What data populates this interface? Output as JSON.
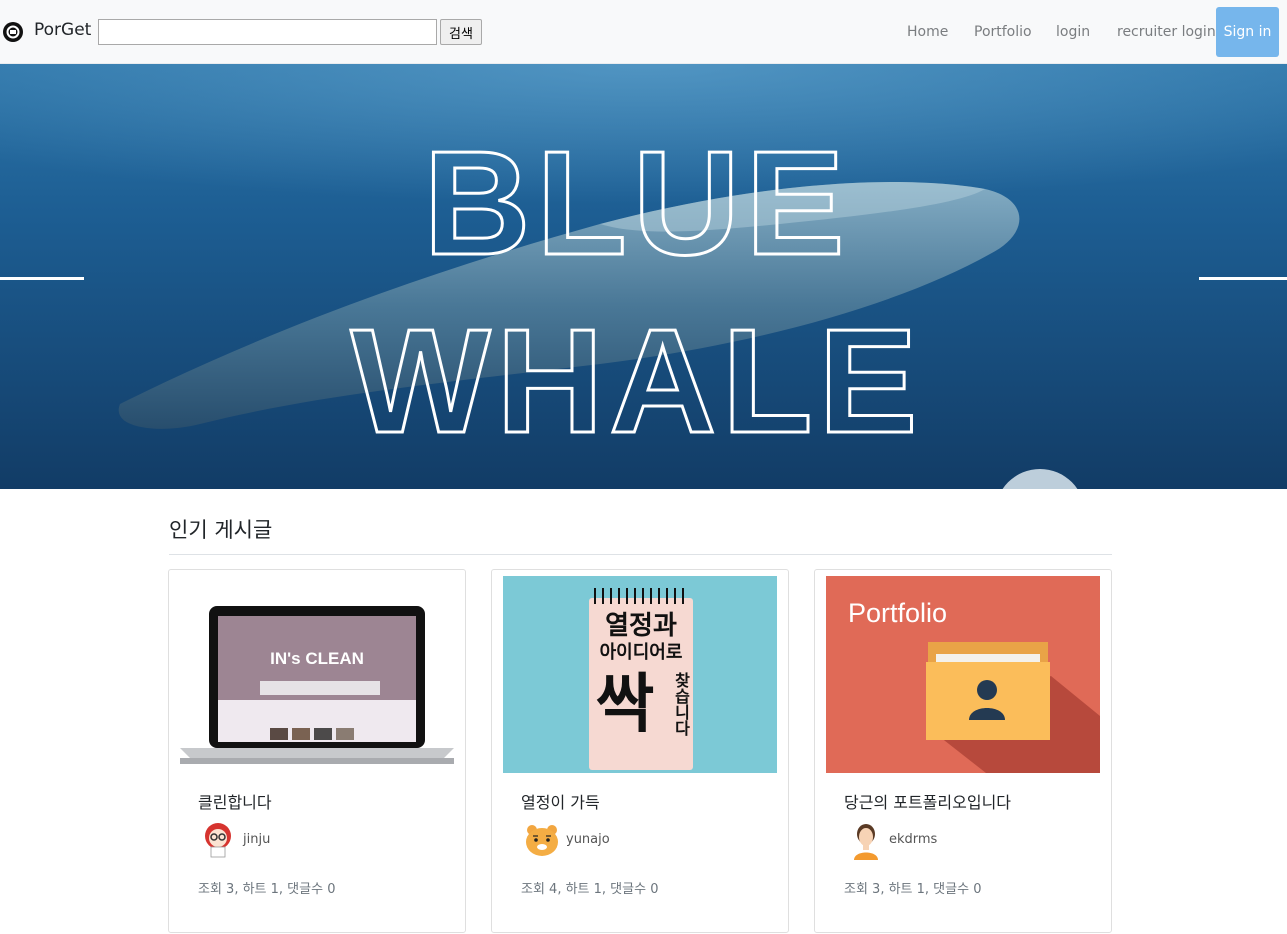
{
  "navbar": {
    "brand": "PorGet",
    "search": {
      "value": "",
      "placeholder": "",
      "button": "검색"
    },
    "links": [
      "Home",
      "Portfolio",
      "login",
      "recruiter login"
    ],
    "signin": "Sign in"
  },
  "hero": {
    "line1": "BLUE",
    "line2": "WHALE"
  },
  "section": {
    "title": "인기 게시글"
  },
  "cards": [
    {
      "thumb_text": "IN's CLEAN",
      "title": "클린합니다",
      "author": "jinju",
      "stats": "조회 3, 하트 1, 댓글수 0"
    },
    {
      "thumb_text": [
        "열정과",
        "아이디어로",
        "싹",
        "찾습니다"
      ],
      "title": "열정이 가득",
      "author": "yunajo",
      "stats": "조회 4, 하트 1, 댓글수 0"
    },
    {
      "thumb_text": "Portfolio",
      "title": "당근의 포트폴리오입니다",
      "author": "ekdrms",
      "stats": "조회 3, 하트 1, 댓글수 0"
    }
  ],
  "colors": {
    "accent": "#76b6ec",
    "navbar_bg": "#f8f9fa",
    "hero_blue": "#1d5587",
    "portfolio_red": "#e06a57"
  }
}
